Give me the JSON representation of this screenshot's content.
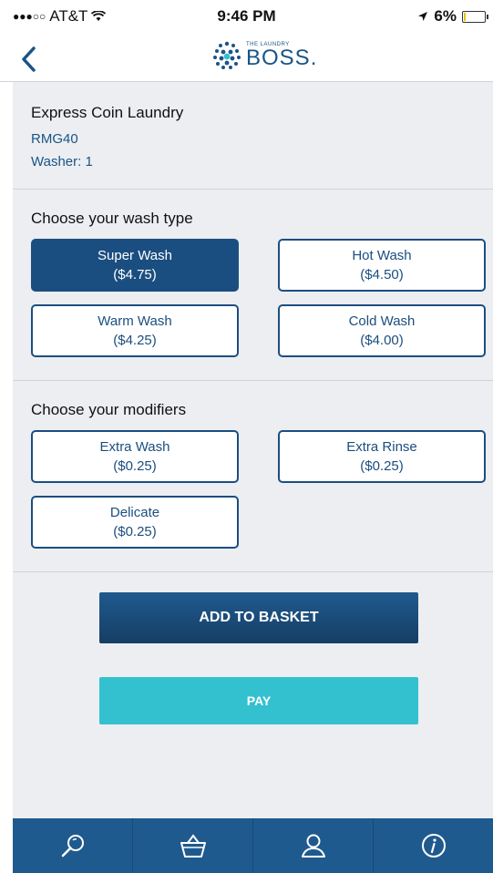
{
  "status_bar": {
    "carrier": "AT&T",
    "time": "9:46 PM",
    "battery": "6%",
    "battery_level": 0.06
  },
  "nav": {
    "logo_small": "THE LAUNDRY",
    "logo_big": "BOSS."
  },
  "venue": {
    "name": "Express Coin Laundry",
    "code": "RMG40",
    "washer": "Washer: 1"
  },
  "wash_type": {
    "title": "Choose your wash type",
    "options": [
      {
        "name": "Super Wash",
        "price": "($4.75)",
        "selected": true
      },
      {
        "name": "Hot Wash",
        "price": "($4.50)",
        "selected": false
      },
      {
        "name": "Warm Wash",
        "price": "($4.25)",
        "selected": false
      },
      {
        "name": "Cold Wash",
        "price": "($4.00)",
        "selected": false
      }
    ]
  },
  "modifiers": {
    "title": "Choose your modifiers",
    "options": [
      {
        "name": "Extra Wash",
        "price": "($0.25)"
      },
      {
        "name": "Extra Rinse",
        "price": "($0.25)"
      },
      {
        "name": "Delicate",
        "price": "($0.25)"
      }
    ]
  },
  "actions": {
    "add_to_basket": "ADD TO BASKET",
    "pay": "PAY"
  },
  "tabs": [
    {
      "icon": "search-icon"
    },
    {
      "icon": "basket-icon"
    },
    {
      "icon": "user-icon"
    },
    {
      "icon": "info-icon"
    }
  ],
  "colors": {
    "primary": "#1b4e80",
    "accent": "#33c0cf",
    "background": "#eceef1"
  }
}
